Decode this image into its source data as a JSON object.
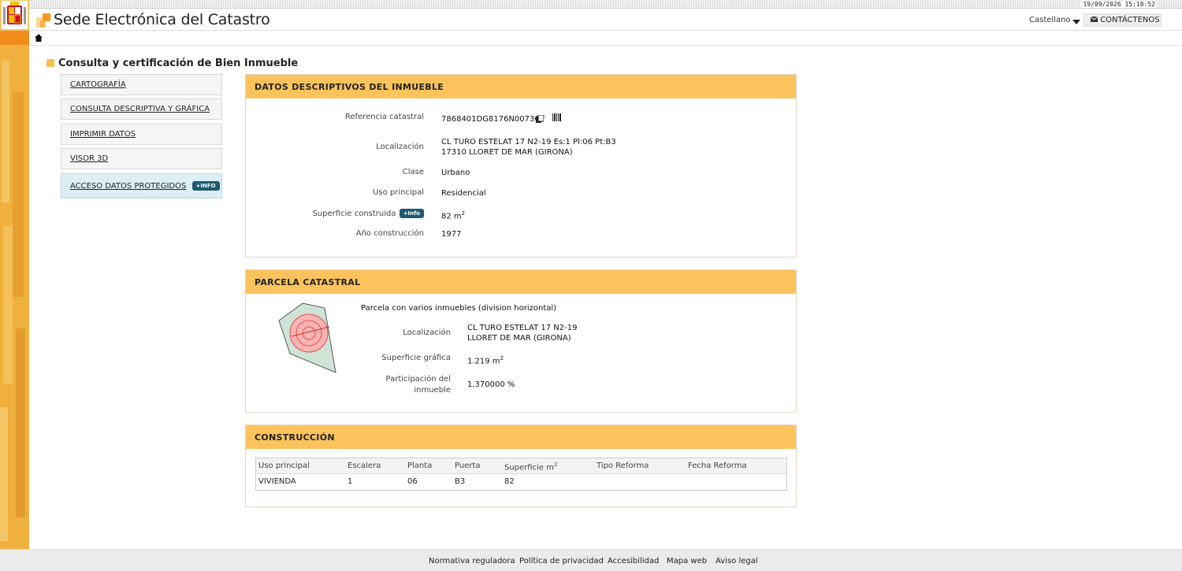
{
  "header": {
    "datetime": "19/09/2026  15:18:52",
    "site_title": "Sede Electrónica del Catastro",
    "language": "Castellano",
    "contact_label": "CONTÁCTENOS",
    "icons": {
      "logo": "catastro-logo-icon",
      "crest": "spain-crest-icon",
      "home": "home-icon",
      "envelope": "envelope-icon",
      "caret": "chevron-down-icon"
    }
  },
  "page_title": "Consulta y certificación de Bien Inmueble",
  "menu": {
    "items": [
      {
        "label": "CARTOGRAFÍA"
      },
      {
        "label": "CONSULTA DESCRIPTIVA Y GRÁFICA"
      },
      {
        "label": "IMPRIMIR DATOS"
      },
      {
        "label": "VISOR 3D"
      },
      {
        "label": "ACCESO DATOS PROTEGIDOS",
        "badge": "+INFO"
      }
    ]
  },
  "descriptivos": {
    "title": "DATOS DESCRIPTIVOS DEL INMUEBLE",
    "ref_label": "Referencia catastral",
    "ref_value": "7868401DG8176N0073OF",
    "loc_label": "Localización",
    "loc_line1": "CL TURO ESTELAT 17 N2-19 Es:1 Pl:06 Pt:B3",
    "loc_line2": "17310 LLORET DE MAR (GIRONA)",
    "clase_label": "Clase",
    "clase_value": "Urbano",
    "uso_label": "Uso principal",
    "uso_value": "Residencial",
    "sup_label": "Superficie construida",
    "sup_badge": "+Info",
    "sup_value": "82 m",
    "sup_unit_exp": "2",
    "ano_label": "Año construcción",
    "ano_value": "1977"
  },
  "parcela": {
    "title": "PARCELA CATASTRAL",
    "note": "Parcela con varios inmuebles (division horizontal)",
    "loc_label": "Localización",
    "loc_line1": "CL TURO ESTELAT 17 N2-19",
    "loc_line2": "LLORET DE MAR (GIRONA)",
    "supg_label": "Superficie gráfica",
    "supg_value": "1.219 m",
    "supg_exp": "2",
    "part_label_1": "Participación del",
    "part_label_2": "inmueble",
    "part_value": "1,370000 %"
  },
  "construccion": {
    "title": "CONSTRUCCIÓN",
    "columns": [
      "Uso principal",
      "Escalera",
      "Planta",
      "Puerta",
      "Superficie m",
      "Tipo Reforma",
      "Fecha Reforma"
    ],
    "col_sup_exp": "2",
    "rows": [
      [
        "VIVIENDA",
        "1",
        "06",
        "B3",
        "82",
        "",
        ""
      ]
    ]
  },
  "footer": {
    "links": [
      "Normativa reguladora",
      "Política de privacidad",
      "Accesibilidad",
      "Mapa web",
      "Aviso legal"
    ]
  },
  "colors": {
    "accent": "#fcc35c",
    "badge": "#1e5a72",
    "strip_orange": "#f28b1a"
  }
}
